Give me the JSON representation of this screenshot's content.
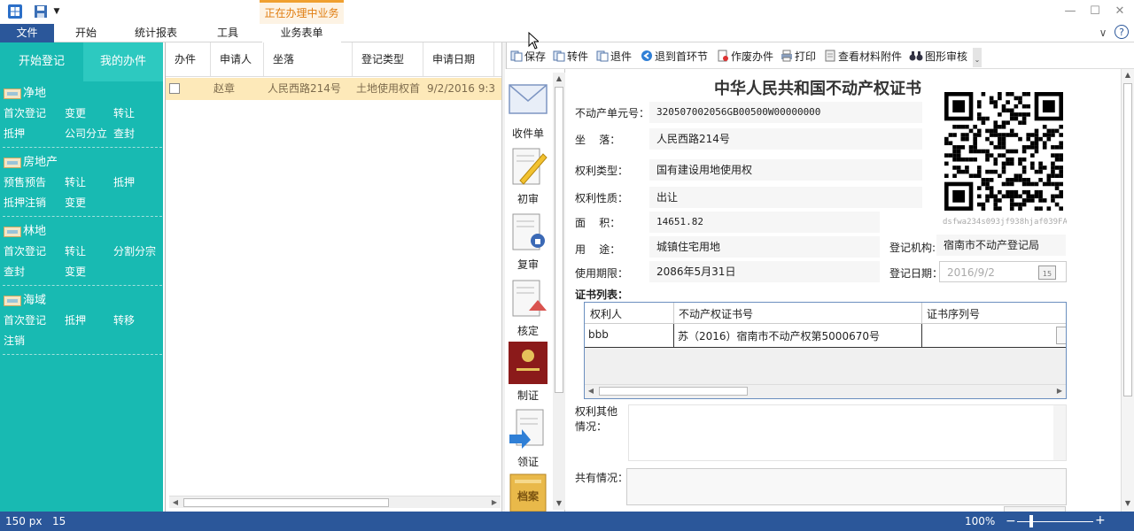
{
  "quick_access": {
    "app_icon": "windows-logo-icon",
    "save_icon": "floppy-disk-icon",
    "dropdown_icon": "dropdown-arrow-icon"
  },
  "window_controls": {
    "minimize": "—",
    "maximize": "☐",
    "close": "✕"
  },
  "ribbon": {
    "context_group": "正在办理中业务",
    "tabs": [
      {
        "label": "文件"
      },
      {
        "label": "开始"
      },
      {
        "label": "统计报表"
      },
      {
        "label": "工具"
      },
      {
        "label": "业务表单"
      }
    ],
    "collapse_icon": "∨",
    "help_icon": "?"
  },
  "left_panel": {
    "tabs": [
      {
        "label": "开始登记"
      },
      {
        "label": "我的办件"
      }
    ],
    "sections": [
      {
        "title": "净地",
        "links": [
          "首次登记",
          "变更",
          "转让",
          "抵押",
          "公司分立",
          "查封"
        ]
      },
      {
        "title": "房地产",
        "links": [
          "预售预告",
          "转让",
          "抵押",
          "抵押注销",
          "变更"
        ]
      },
      {
        "title": "林地",
        "links": [
          "首次登记",
          "转让",
          "分割分宗",
          "查封",
          "变更"
        ]
      },
      {
        "title": "海域",
        "links": [
          "首次登记",
          "抵押",
          "转移",
          "注销"
        ]
      }
    ]
  },
  "list": {
    "columns": [
      "办件",
      "申请人",
      "坐落",
      "登记类型",
      "申请日期"
    ],
    "rows": [
      {
        "applicant": "赵章",
        "location": "人民西路214号",
        "type": "土地使用权首",
        "date": "9/2/2016 9:3"
      }
    ]
  },
  "toolbar": {
    "buttons": [
      "保存",
      "转件",
      "退件",
      "退到首环节",
      "作废办件",
      "打印",
      "查看材料附件",
      "图形审核"
    ]
  },
  "steps": [
    "收件单",
    "初审",
    "复审",
    "核定",
    "制证",
    "领证",
    "档案"
  ],
  "form": {
    "title": "中华人民共和国不动产权证书",
    "unit_no_label": "不动产单元号：",
    "unit_no": "320507002056GB00500W00000000",
    "location_label": "坐    落：",
    "location": "人民西路214号",
    "right_type_label": "权利类型：",
    "right_type": "国有建设用地使用权",
    "right_nature_label": "权利性质：",
    "right_nature": "出让",
    "area_label": "面    积：",
    "area": "14651.82",
    "qr_caption": "dsfwa234s093jf938hjaf039FA",
    "usage_label": "用    途：",
    "usage": "城镇住宅用地",
    "reg_org_label": "登记机构:",
    "reg_org": "宿南市不动产登记局",
    "period_label": "使用期限：",
    "period": "2086年5月31日",
    "reg_date_label": "登记日期：",
    "reg_date": "2016/9/2",
    "calendar_icon": "15",
    "cert_list_label": "证书列表：",
    "cert_columns": [
      "权利人",
      "不动产权证书号",
      "证书序列号"
    ],
    "cert_rows": [
      {
        "holder": "bbb",
        "cert_no": "苏（2016）宿南市不动产权第5000670号",
        "serial": ""
      }
    ],
    "other_label": "权利其他\n情况：",
    "share_label": "共有情况："
  },
  "status": {
    "left": "150 px",
    "count": "15",
    "zoom": "100%"
  }
}
